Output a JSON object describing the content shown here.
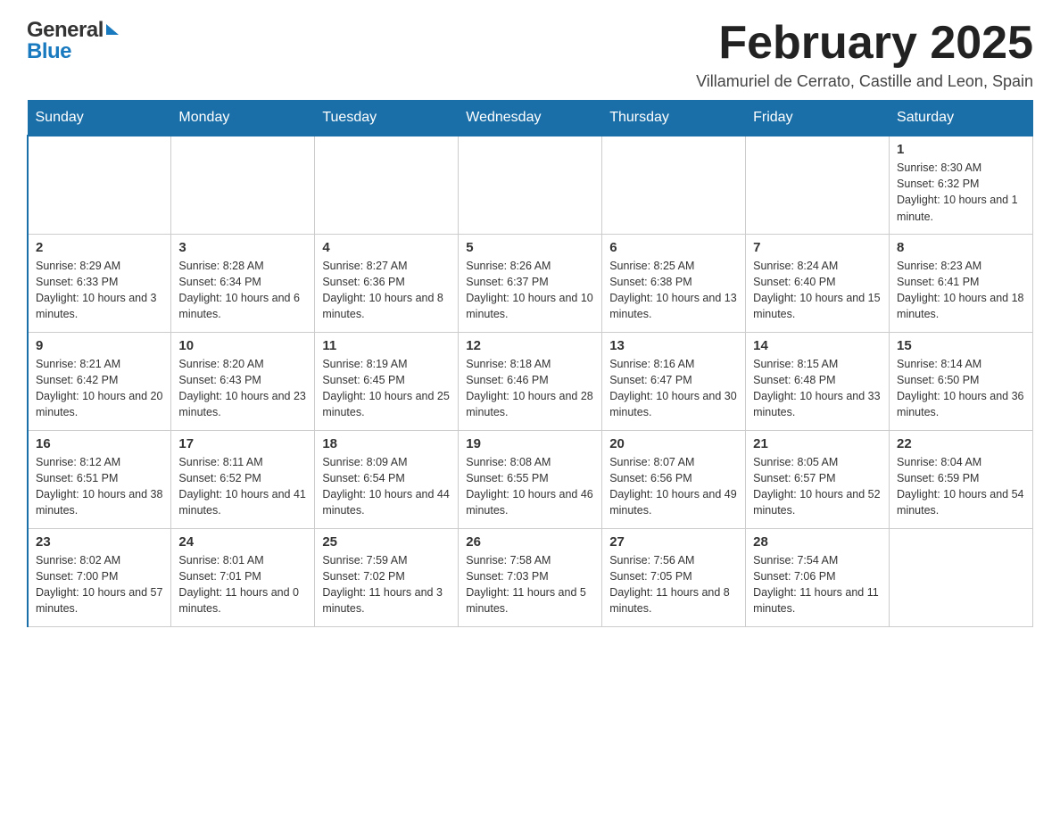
{
  "logo": {
    "general": "General",
    "blue": "Blue"
  },
  "title": "February 2025",
  "subtitle": "Villamuriel de Cerrato, Castille and Leon, Spain",
  "days_of_week": [
    "Sunday",
    "Monday",
    "Tuesday",
    "Wednesday",
    "Thursday",
    "Friday",
    "Saturday"
  ],
  "weeks": [
    [
      {
        "day": "",
        "info": ""
      },
      {
        "day": "",
        "info": ""
      },
      {
        "day": "",
        "info": ""
      },
      {
        "day": "",
        "info": ""
      },
      {
        "day": "",
        "info": ""
      },
      {
        "day": "",
        "info": ""
      },
      {
        "day": "1",
        "info": "Sunrise: 8:30 AM\nSunset: 6:32 PM\nDaylight: 10 hours and 1 minute."
      }
    ],
    [
      {
        "day": "2",
        "info": "Sunrise: 8:29 AM\nSunset: 6:33 PM\nDaylight: 10 hours and 3 minutes."
      },
      {
        "day": "3",
        "info": "Sunrise: 8:28 AM\nSunset: 6:34 PM\nDaylight: 10 hours and 6 minutes."
      },
      {
        "day": "4",
        "info": "Sunrise: 8:27 AM\nSunset: 6:36 PM\nDaylight: 10 hours and 8 minutes."
      },
      {
        "day": "5",
        "info": "Sunrise: 8:26 AM\nSunset: 6:37 PM\nDaylight: 10 hours and 10 minutes."
      },
      {
        "day": "6",
        "info": "Sunrise: 8:25 AM\nSunset: 6:38 PM\nDaylight: 10 hours and 13 minutes."
      },
      {
        "day": "7",
        "info": "Sunrise: 8:24 AM\nSunset: 6:40 PM\nDaylight: 10 hours and 15 minutes."
      },
      {
        "day": "8",
        "info": "Sunrise: 8:23 AM\nSunset: 6:41 PM\nDaylight: 10 hours and 18 minutes."
      }
    ],
    [
      {
        "day": "9",
        "info": "Sunrise: 8:21 AM\nSunset: 6:42 PM\nDaylight: 10 hours and 20 minutes."
      },
      {
        "day": "10",
        "info": "Sunrise: 8:20 AM\nSunset: 6:43 PM\nDaylight: 10 hours and 23 minutes."
      },
      {
        "day": "11",
        "info": "Sunrise: 8:19 AM\nSunset: 6:45 PM\nDaylight: 10 hours and 25 minutes."
      },
      {
        "day": "12",
        "info": "Sunrise: 8:18 AM\nSunset: 6:46 PM\nDaylight: 10 hours and 28 minutes."
      },
      {
        "day": "13",
        "info": "Sunrise: 8:16 AM\nSunset: 6:47 PM\nDaylight: 10 hours and 30 minutes."
      },
      {
        "day": "14",
        "info": "Sunrise: 8:15 AM\nSunset: 6:48 PM\nDaylight: 10 hours and 33 minutes."
      },
      {
        "day": "15",
        "info": "Sunrise: 8:14 AM\nSunset: 6:50 PM\nDaylight: 10 hours and 36 minutes."
      }
    ],
    [
      {
        "day": "16",
        "info": "Sunrise: 8:12 AM\nSunset: 6:51 PM\nDaylight: 10 hours and 38 minutes."
      },
      {
        "day": "17",
        "info": "Sunrise: 8:11 AM\nSunset: 6:52 PM\nDaylight: 10 hours and 41 minutes."
      },
      {
        "day": "18",
        "info": "Sunrise: 8:09 AM\nSunset: 6:54 PM\nDaylight: 10 hours and 44 minutes."
      },
      {
        "day": "19",
        "info": "Sunrise: 8:08 AM\nSunset: 6:55 PM\nDaylight: 10 hours and 46 minutes."
      },
      {
        "day": "20",
        "info": "Sunrise: 8:07 AM\nSunset: 6:56 PM\nDaylight: 10 hours and 49 minutes."
      },
      {
        "day": "21",
        "info": "Sunrise: 8:05 AM\nSunset: 6:57 PM\nDaylight: 10 hours and 52 minutes."
      },
      {
        "day": "22",
        "info": "Sunrise: 8:04 AM\nSunset: 6:59 PM\nDaylight: 10 hours and 54 minutes."
      }
    ],
    [
      {
        "day": "23",
        "info": "Sunrise: 8:02 AM\nSunset: 7:00 PM\nDaylight: 10 hours and 57 minutes."
      },
      {
        "day": "24",
        "info": "Sunrise: 8:01 AM\nSunset: 7:01 PM\nDaylight: 11 hours and 0 minutes."
      },
      {
        "day": "25",
        "info": "Sunrise: 7:59 AM\nSunset: 7:02 PM\nDaylight: 11 hours and 3 minutes."
      },
      {
        "day": "26",
        "info": "Sunrise: 7:58 AM\nSunset: 7:03 PM\nDaylight: 11 hours and 5 minutes."
      },
      {
        "day": "27",
        "info": "Sunrise: 7:56 AM\nSunset: 7:05 PM\nDaylight: 11 hours and 8 minutes."
      },
      {
        "day": "28",
        "info": "Sunrise: 7:54 AM\nSunset: 7:06 PM\nDaylight: 11 hours and 11 minutes."
      },
      {
        "day": "",
        "info": ""
      }
    ]
  ]
}
